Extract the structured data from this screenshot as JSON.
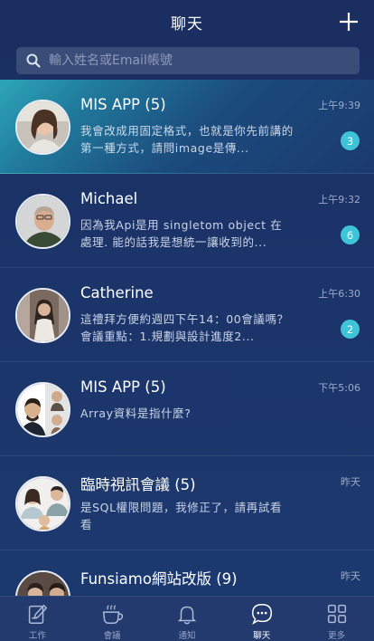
{
  "header": {
    "title": "聊天",
    "add_icon": "plus-icon"
  },
  "search": {
    "placeholder": "輸入姓名或Email帳號",
    "icon": "search-icon"
  },
  "chats": [
    {
      "name": "MIS APP (5)",
      "message": "我會改成用固定格式，也就是你先前講的第一種方式，請問image是傳...",
      "time": "上午9:39",
      "badge": "3",
      "avatar": "group-avatar"
    },
    {
      "name": "Michael",
      "message": "因為我Api是用 singletom object 在處理. 能的話我是想統一讓收到的...",
      "time": "上午9:32",
      "badge": "6",
      "avatar": "person-avatar"
    },
    {
      "name": "Catherine",
      "message": "這禮拜方便約週四下午14：00會議嗎？會議重點：1.規劃與設計進度2...",
      "time": "上午6:30",
      "badge": "2",
      "avatar": "person-avatar"
    },
    {
      "name": "MIS APP (5)",
      "message": "Array資料是指什麼?",
      "time": "下午5:06",
      "badge": "",
      "avatar": "group-avatar"
    },
    {
      "name": "臨時視訊會議 (5)",
      "message": "是SQL權限問題，我修正了，請再試看看",
      "time": "昨天",
      "badge": "",
      "avatar": "group-avatar"
    },
    {
      "name": "Funsiamo網站改版 (9)",
      "message": "",
      "time": "昨天",
      "badge": "",
      "avatar": "group-avatar"
    }
  ],
  "tabs": [
    {
      "label": "工作",
      "icon": "edit-icon"
    },
    {
      "label": "會議",
      "icon": "cup-icon"
    },
    {
      "label": "通知",
      "icon": "bell-icon"
    },
    {
      "label": "聊天",
      "icon": "chat-icon"
    },
    {
      "label": "更多",
      "icon": "grid-icon"
    }
  ],
  "colors": {
    "badge": "#3fc4d7",
    "background": "#1b3469",
    "highlight": "#2da6b8"
  }
}
